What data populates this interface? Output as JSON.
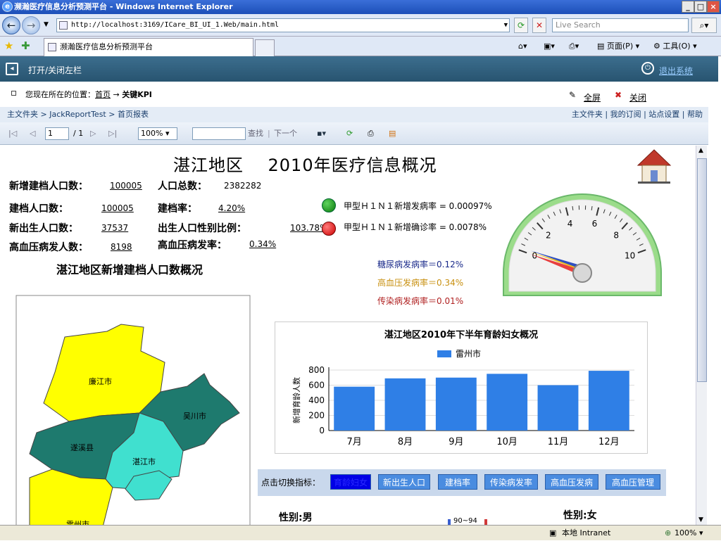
{
  "browser": {
    "title": "濒瀚医疗信息分析预测平台 - Windows Internet Explorer",
    "url": "http://localhost:3169/ICare_BI_UI_1.Web/main.html",
    "search_placeholder": "Live Search",
    "tab_title": "濒瀚医疗信息分析预测平台",
    "menu_page": "页面(P)",
    "menu_tools": "工具(O)"
  },
  "app": {
    "toggle_left": "打开/关闭左栏",
    "logout": "退出系统",
    "location_prefix": "您现在所在的位置：",
    "location_home": "首页",
    "location_arrow": "→",
    "location_current": "关键KPI",
    "fullscreen": "全屏",
    "close": "关闭"
  },
  "report_nav": {
    "left": "主文件夹  > JackReportTest > 首页报表",
    "right": "主文件夹 | 我的订阅 | 站点设置 | 帮助"
  },
  "report_toolbar": {
    "page": "1",
    "of": "/ 1",
    "zoom": "100%",
    "find": "查找",
    "next": "下一个"
  },
  "report": {
    "title": "湛江地区    2010年医疗信息概况",
    "kpi": {
      "new_archived_label": "新增建档人口数：",
      "new_archived_value": "100005",
      "total_label": "人口总数：",
      "total_value": "2382282",
      "archived_label": "建档人口数：",
      "archived_value": "100005",
      "archive_rate_label": "建档率：",
      "archive_rate_value": "4.20%",
      "newborn_label": "新出生人口数：",
      "newborn_value": "37537",
      "sex_ratio_label": "出生人口性别比例：",
      "sex_ratio_value": "103.78%",
      "hyper_count_label": "高血压病发人数：",
      "hyper_count_value": "8198",
      "hyper_rate_label": "高血压病发率：",
      "hyper_rate_value": "0.34%"
    },
    "h1n1_new": "甲型Ｈ１Ｎ１新增发病率  = 0.00097%",
    "h1n1_confirm": "甲型Ｈ１Ｎ１新增确诊率  = 0.0078%",
    "diabetes": "糖尿病发病率＝0.12%",
    "hypertension": "高血压发病率＝0.34%",
    "infectious": "传染病发病率＝0.01%",
    "map_title": "湛江地区新增建档人口数概况",
    "map_regions": [
      "廉江市",
      "吴川市",
      "遂溪县",
      "湛江市",
      "雷州市"
    ],
    "gauge_ticks": [
      "0",
      "2",
      "4",
      "6",
      "8",
      "10"
    ],
    "gauge_value": 0,
    "switch_label": "点击切换指标：",
    "switch_buttons": [
      "育龄妇女",
      "新出生人口",
      "建档率",
      "传染病发率",
      "高血压发病",
      "高血压管理"
    ],
    "gender_male": "性别:男",
    "gender_female": "性别:女",
    "pyramid_label": "90~94"
  },
  "chart_data": {
    "type": "bar",
    "title": "湛江地区2010年下半年育龄妇女概况",
    "categories": [
      "7月",
      "8月",
      "9月",
      "10月",
      "11月",
      "12月"
    ],
    "series": [
      {
        "name": "雷州市",
        "values": [
          580,
          690,
          700,
          750,
          600,
          790
        ]
      }
    ],
    "ylabel": "新增育龄人数",
    "ylim": [
      0,
      800
    ],
    "yticks": [
      "0",
      "200",
      "400",
      "600",
      "800"
    ],
    "color": "#2f7fe6"
  },
  "status": {
    "zone": "本地 Intranet",
    "zoom": "100%"
  }
}
